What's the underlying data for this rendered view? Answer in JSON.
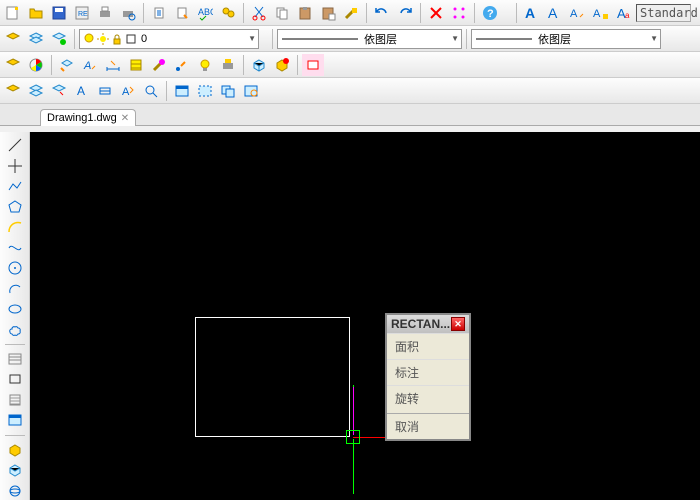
{
  "toolbar1": {
    "icons": [
      "new",
      "open",
      "save",
      "reis",
      "print",
      "preview",
      "export",
      "export2",
      "spell",
      "find",
      "cut",
      "copy",
      "paste",
      "clipboard",
      "brush",
      "undo",
      "redo",
      "delete",
      "snap",
      "help"
    ],
    "text_icons": [
      "font-a",
      "font-a2",
      "style1",
      "style2",
      "style3"
    ],
    "style_box": "Standard"
  },
  "toolbar2": {
    "layer_value": "0",
    "linetype_label": "依图层",
    "lineweight_label": "依图层"
  },
  "toolbar3": {
    "icons": [
      "iso",
      "color",
      "match",
      "text",
      "dim",
      "hatch",
      "brush2",
      "point",
      "bulb",
      "print2",
      "grid",
      "toggle",
      "rect"
    ]
  },
  "toolbar4": {
    "icons": [
      "sel1",
      "sel2",
      "isolate",
      "text2",
      "dim2",
      "props",
      "pick",
      "win",
      "cross",
      "fence",
      "all"
    ]
  },
  "tab": {
    "name": "Drawing1.dwg"
  },
  "side_tools": [
    "line",
    "point",
    "polyline",
    "arc",
    "curve",
    "spline",
    "circle",
    "arc2",
    "ellipse",
    "revcloud",
    "",
    "text",
    "rect",
    "hatch",
    "table",
    "",
    "block",
    "insert",
    "region",
    "gap",
    "3d"
  ],
  "popup": {
    "title": "RECTAN...",
    "items": [
      "面积",
      "标注",
      "旋转",
      "取消"
    ]
  }
}
